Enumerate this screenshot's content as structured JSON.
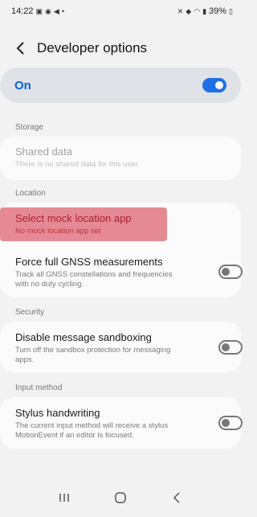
{
  "status_bar": {
    "time": "14:22",
    "battery": "39%"
  },
  "header": {
    "title": "Developer options"
  },
  "master_toggle": {
    "label": "On",
    "state": "on"
  },
  "sections": {
    "storage": {
      "header": "Storage",
      "shared_data": {
        "title": "Shared data",
        "subtitle": "There is no shared data for this user."
      }
    },
    "location": {
      "header": "Location",
      "mock_location": {
        "title": "Select mock location app",
        "subtitle": "No mock location app set"
      },
      "gnss": {
        "title": "Force full GNSS measurements",
        "subtitle_line1": "Track all GNSS constellations and frequencies",
        "subtitle_line2": "with no duty cycling.",
        "state": "off"
      }
    },
    "security": {
      "header": "Security",
      "sandboxing": {
        "title": "Disable message sandboxing",
        "subtitle_line1": "Turn off the sandbox protection for messaging",
        "subtitle_line2": "apps.",
        "state": "off"
      }
    },
    "input_method": {
      "header": "Input method",
      "stylus": {
        "title": "Stylus handwriting",
        "subtitle_line1": "The current input method will receive a stylus",
        "subtitle_line2": "MotionEvent if an editor is focused.",
        "state": "off"
      }
    }
  },
  "colors": {
    "accent": "#1f6fe6",
    "highlight": "#e58a95"
  }
}
